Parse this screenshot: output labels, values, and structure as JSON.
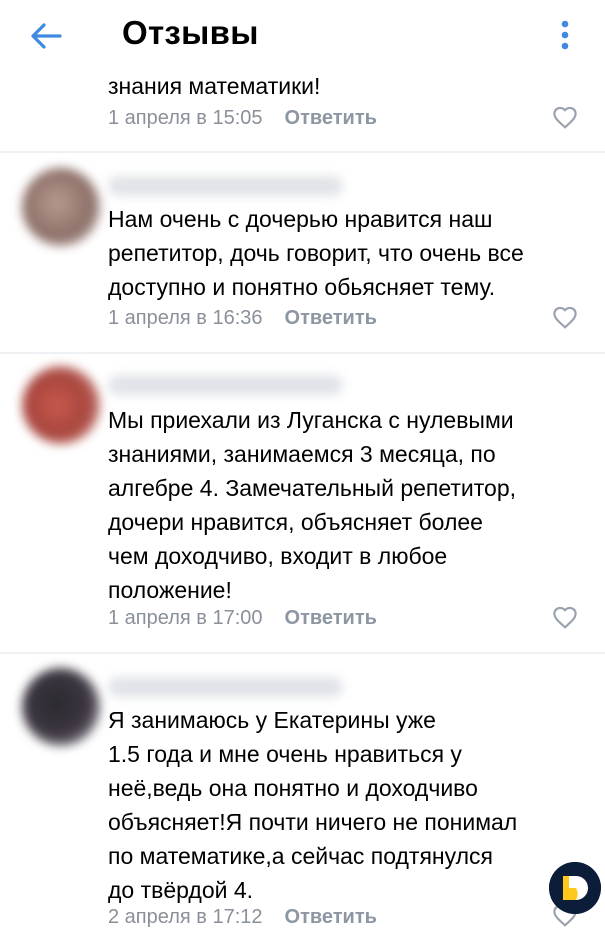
{
  "header": {
    "title": "Отзывы",
    "back_icon": "arrow-left-icon",
    "more_icon": "more-vertical-icon",
    "accent_color": "#3f8ae0"
  },
  "comments": [
    {
      "text": "знания математики!",
      "date": "1 апреля в 15:05",
      "reply_label": "Ответить"
    },
    {
      "text": "Нам очень с дочерью нравится наш\nрепетитор, дочь говорит, что очень все\nдоступно и понятно обьясняет тему.",
      "date": "1 апреля в 16:36",
      "reply_label": "Ответить"
    },
    {
      "text": "Мы приехали из Луганска с нулевыми\nзнаниями, занимаемся 3 месяца, по\nалгебре 4. Замечательный репетитор,\nдочери нравится, объясняет более\nчем доходчиво,  входит в любое\nположение!",
      "date": "1 апреля в 17:00",
      "reply_label": "Ответить"
    },
    {
      "text": "Я занимаюсь у Екатерины уже\n1.5 года и мне очень нравиться у\nнеё,ведь она понятно и доходчиво\nобъясняет!Я почти ничего не понимал\nпо математике,а сейчас подтянулся\nдо твёрдой 4.",
      "date": "2 апреля в 17:12",
      "reply_label": "Ответить"
    }
  ],
  "like_icon": "heart-outline-icon",
  "corner_logo_icon": "app-logo-icon",
  "colors": {
    "meta_text": "#8a9099",
    "divider": "#eef0f3",
    "logo_dark": "#0c1d3a",
    "logo_yellow": "#ffc81a"
  }
}
